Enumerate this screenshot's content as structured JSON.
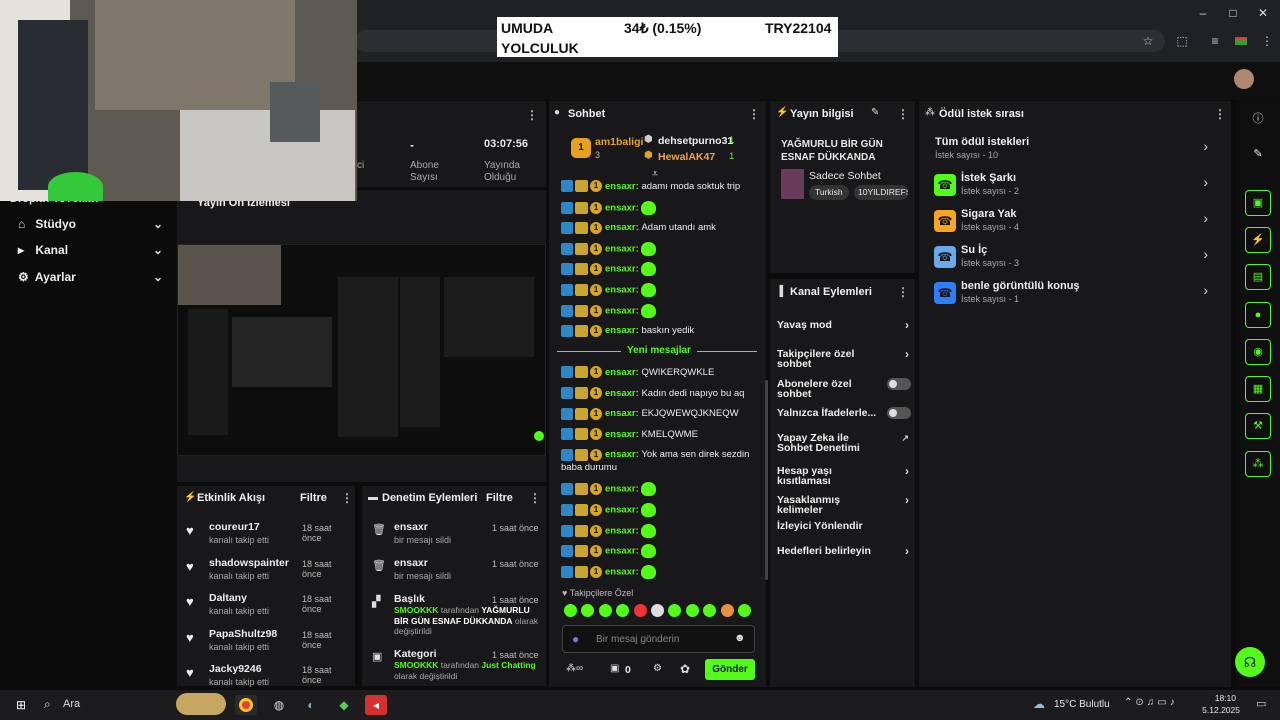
{
  "ticker": {
    "line1": "UMUDA",
    "line2": "YOLCULUK",
    "change": "34₺ (0.15%)",
    "code": "TRY22104"
  },
  "stats": {
    "abone_value": "-",
    "abone_label": "Abone Sayısı",
    "time_value": "03:07:56",
    "time_label": "Yayında Olduğu",
    "partial_label": "ci"
  },
  "sidebar": {
    "partial_top": "Dropla? ro?ekla?",
    "items": [
      {
        "label": "Stüdyo",
        "icon": "studio-icon"
      },
      {
        "label": "Kanal",
        "icon": "channel-icon"
      },
      {
        "label": "Ayarlar",
        "icon": "gear-icon"
      }
    ]
  },
  "preview": {
    "title": "Yayın Ön İzlemesi"
  },
  "activity": {
    "title": "Etkinlik Akışı",
    "filter": "Filtre",
    "rows": [
      {
        "name": "coureur17",
        "sub": "kanalı takip etti",
        "time": "18 saat önce"
      },
      {
        "name": "shadowspainter",
        "sub": "kanalı takip etti",
        "time": "18 saat önce"
      },
      {
        "name": "Daltany",
        "sub": "kanalı takip etti",
        "time": "18 saat önce"
      },
      {
        "name": "PapaShultz98",
        "sub": "kanalı takip etti",
        "time": "18 saat önce"
      },
      {
        "name": "Jacky9246",
        "sub": "kanalı takip etti",
        "time": "18 saat önce"
      }
    ]
  },
  "moderation": {
    "title": "Denetim Eylemleri",
    "filter": "Filtre",
    "rows": [
      {
        "name": "ensaxr",
        "sub": "bir mesajı sildi",
        "time": "1 saat önce"
      },
      {
        "name": "ensaxr",
        "sub": "bir mesajı sildi",
        "time": "1 saat önce"
      },
      {
        "name": "Başlık",
        "time": "1 saat önce",
        "actor": "SMOOKKK",
        "mid": " tarafından ",
        "target": "YAĞMURLU BİR GÜN ESNAF DÜKKANDA",
        "end": " olarak değiştirildi"
      },
      {
        "name": "Kategori",
        "time": "1 saat önce",
        "actor": "SMOOKKK",
        "mid": " tarafından ",
        "target": "Just Chatting",
        "end": " olarak değiştirildi"
      }
    ]
  },
  "chat": {
    "title": "Sohbet",
    "leaders": [
      {
        "name": "am1baligi",
        "rank": "1",
        "count": "3"
      },
      {
        "name": "dehsetpurno31",
        "count": "1"
      },
      {
        "name": "HewalAK47",
        "count": "1"
      }
    ],
    "messages_before": [
      {
        "user": "ensaxr",
        "text": "adamı moda soktuk trip"
      },
      {
        "user": "ensaxr",
        "text": "",
        "emote": true
      },
      {
        "user": "ensaxr",
        "text": "Adam utandı amk"
      },
      {
        "user": "ensaxr",
        "text": "",
        "emote": true
      },
      {
        "user": "ensaxr",
        "text": "",
        "emote": true
      },
      {
        "user": "ensaxr",
        "text": "",
        "emote": true
      },
      {
        "user": "ensaxr",
        "text": "",
        "emote": true
      },
      {
        "user": "ensaxr",
        "text": "baskın yedik"
      }
    ],
    "new_divider": "Yeni mesajlar",
    "messages_after": [
      {
        "user": "ensaxr",
        "text": "QWIKERQWKLE"
      },
      {
        "user": "ensaxr",
        "text": "Kadın dedi napıyo bu aq"
      },
      {
        "user": "ensaxr",
        "text": "EKJQWEWQJKNEQW"
      },
      {
        "user": "ensaxr",
        "text": "KMELQWME"
      },
      {
        "user": "ensaxr",
        "text": "Yok ama sen direk sezdin baba durumu"
      },
      {
        "user": "ensaxr",
        "text": "",
        "emote": true
      },
      {
        "user": "ensaxr",
        "text": "",
        "emote": true
      },
      {
        "user": "ensaxr",
        "text": "",
        "emote": true
      },
      {
        "user": "ensaxr",
        "text": "",
        "emote": true
      },
      {
        "user": "ensaxr",
        "text": "",
        "emote": true
      }
    ],
    "followers_only": "Takipçilere Özel",
    "placeholder": "Bir mesaj gönderin",
    "points": "0",
    "send": "Gönder"
  },
  "stream_info": {
    "title": "Yayın bilgisi",
    "stream_title": "YAĞMURLU BİR GÜN ESNAF DÜKKANDA",
    "category": "Sadece Sohbet",
    "tags": [
      "Turkish",
      "10YILDIREFS"
    ]
  },
  "channel_actions": {
    "title": "Kanal Eylemleri",
    "items": [
      {
        "label": "Yavaş mod",
        "ctl": "chevron"
      },
      {
        "label": "Takipçilere özel sohbet",
        "ctl": "chevron"
      },
      {
        "label": "Abonelere özel sohbet",
        "ctl": "toggle",
        "on": false
      },
      {
        "label": "Yalnızca İfadelerle...",
        "ctl": "toggle",
        "on": false
      },
      {
        "label": "Yapay Zeka ile Sohbet Denetimi",
        "ctl": "external"
      },
      {
        "label": "Hesap yaşı kısıtlaması",
        "ctl": "chevron"
      },
      {
        "label": "Yasaklanmış kelimeler",
        "ctl": "chevron"
      },
      {
        "label": "İzleyici Yönlendir",
        "ctl": "none"
      },
      {
        "label": "Hedefleri belirleyin",
        "ctl": "chevron"
      }
    ]
  },
  "rewards": {
    "title": "Ödül istek sırası",
    "items": [
      {
        "name": "Tüm ödül istekleri",
        "sub": "İstek sayısı - 10",
        "color": ""
      },
      {
        "name": "İstek Şarkı",
        "sub": "İstek sayısı - 2",
        "color": "#53fc18"
      },
      {
        "name": "Sigara Yak",
        "sub": "İstek sayısı - 4",
        "color": "#f5a623"
      },
      {
        "name": "Su İç",
        "sub": "İstek sayısı - 3",
        "color": "#6aa9e9"
      },
      {
        "name": "benle görüntülü konuş",
        "sub": "İstek sayısı - 1",
        "color": "#2d7ff9"
      }
    ]
  },
  "taskbar": {
    "search": "Ara",
    "weather": "15°C Bulutlu",
    "time": "18:10",
    "date": "5.12.2025"
  },
  "colors": {
    "accent": "#53fc18",
    "panel": "#18181a",
    "bg": "#0b0b0c"
  }
}
